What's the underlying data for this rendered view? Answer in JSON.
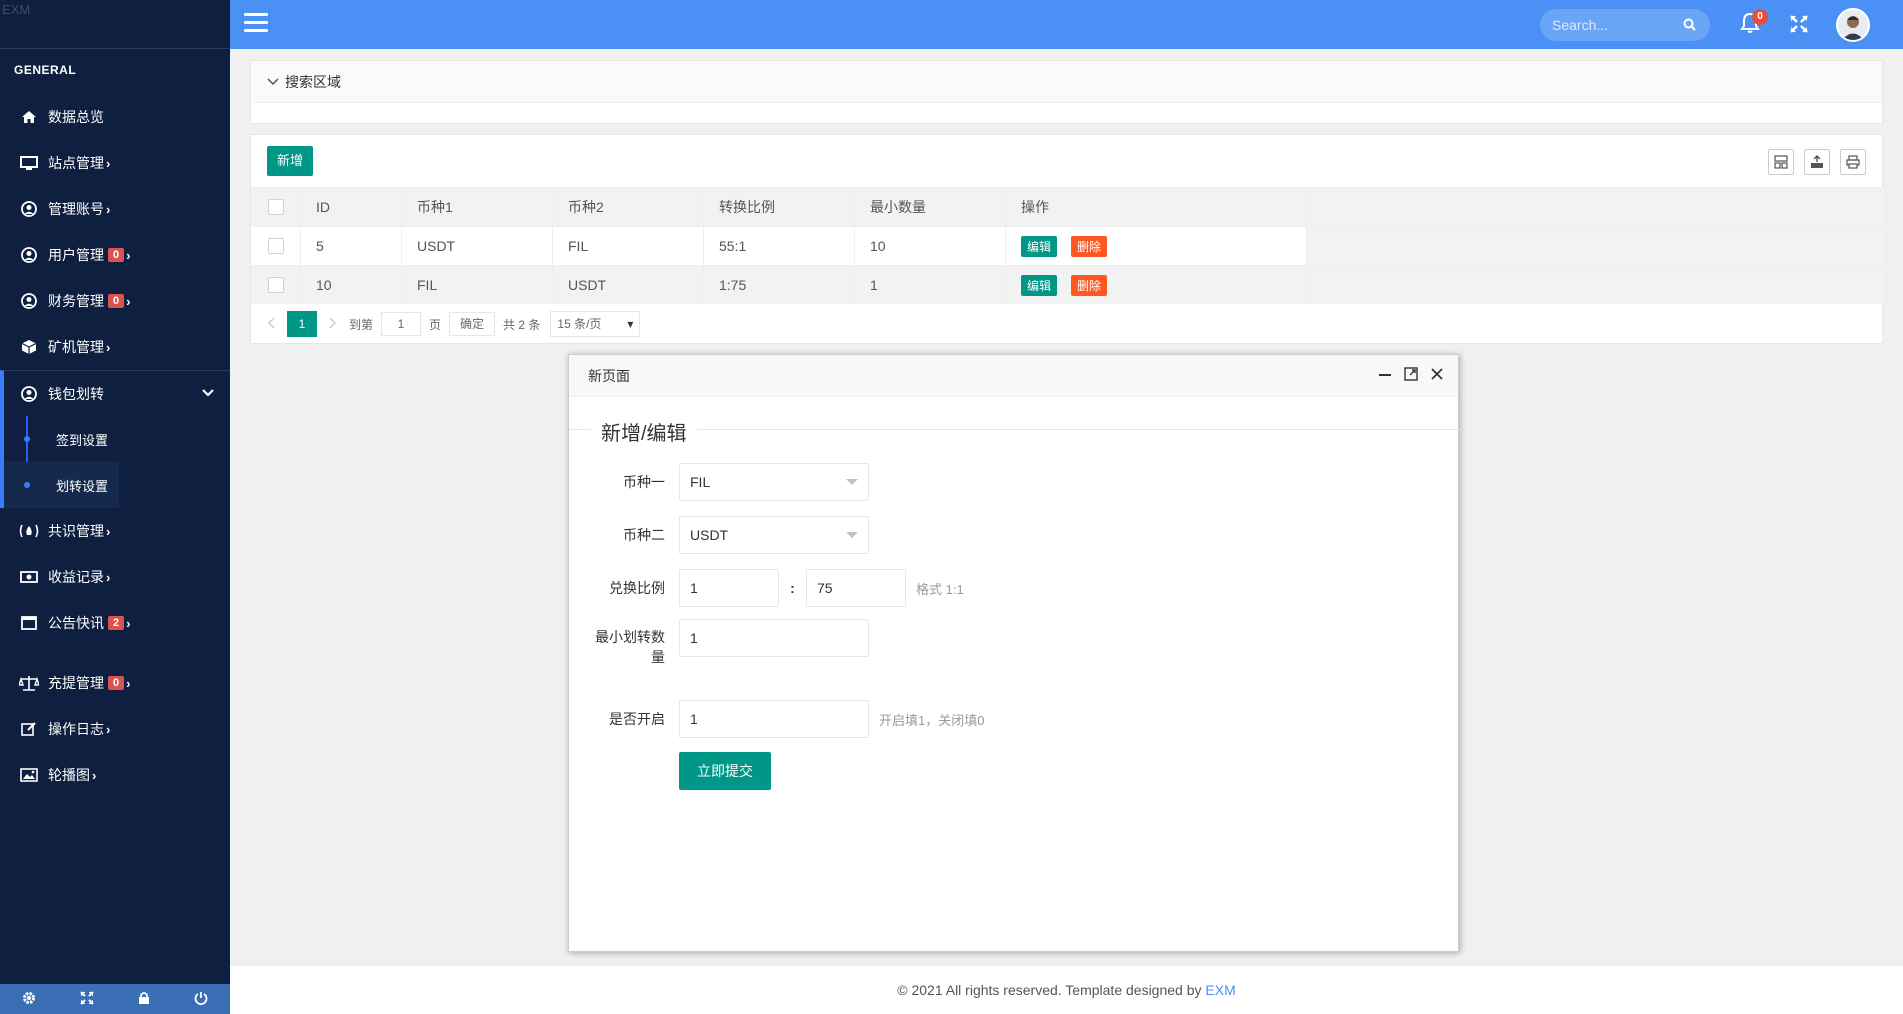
{
  "sidebar": {
    "brand": "EXM",
    "section_title": "GENERAL",
    "items": [
      {
        "label": "数据总览",
        "badge": "",
        "arrow": ""
      },
      {
        "label": "站点管理",
        "badge": "",
        "arrow": "›"
      },
      {
        "label": "管理账号",
        "badge": "",
        "arrow": "›"
      },
      {
        "label": "用户管理",
        "badge": "0",
        "arrow": "›"
      },
      {
        "label": "财务管理",
        "badge": "0",
        "arrow": "›"
      },
      {
        "label": "矿机管理",
        "badge": "",
        "arrow": "›"
      },
      {
        "label": "钱包划转",
        "badge": "",
        "arrow": ""
      },
      {
        "label": "共识管理",
        "badge": "",
        "arrow": "›"
      },
      {
        "label": "收益记录",
        "badge": "",
        "arrow": "›"
      },
      {
        "label": "公告快讯",
        "badge": "2",
        "arrow": "›"
      },
      {
        "label": "充提管理",
        "badge": "0",
        "arrow": "›"
      },
      {
        "label": "操作日志",
        "badge": "",
        "arrow": "›"
      },
      {
        "label": "轮播图",
        "badge": "",
        "arrow": "›"
      }
    ],
    "submenu": [
      "签到设置",
      "划转设置"
    ]
  },
  "header": {
    "search_placeholder": "Search...",
    "notification_count": "0"
  },
  "search_panel": {
    "title": "搜索区域"
  },
  "table": {
    "add_label": "新增",
    "columns": [
      "ID",
      "币种1",
      "币种2",
      "转换比例",
      "最小数量",
      "操作"
    ],
    "rows": [
      {
        "id": "5",
        "coin1": "USDT",
        "coin2": "FIL",
        "ratio": "55:1",
        "min": "10"
      },
      {
        "id": "10",
        "coin1": "FIL",
        "coin2": "USDT",
        "ratio": "1:75",
        "min": "1"
      }
    ],
    "edit_label": "编辑",
    "delete_label": "删除"
  },
  "pager": {
    "current": "1",
    "goto_label": "到第",
    "goto_value": "1",
    "page_label": "页",
    "confirm_label": "确定",
    "total": "共 2 条",
    "per_page": "15 条/页"
  },
  "modal": {
    "title": "新页面",
    "legend": "新增/编辑",
    "fields": {
      "coin1_label": "币种一",
      "coin1_value": "FIL",
      "coin2_label": "币种二",
      "coin2_value": "USDT",
      "ratio_label": "兑换比例",
      "ratio_left": "1",
      "ratio_sep": ":",
      "ratio_right": "75",
      "ratio_hint": "格式 1:1",
      "min_label": "最小划转数量",
      "min_value": "1",
      "open_label": "是否开启",
      "open_value": "1",
      "open_hint": "开启填1，关闭填0"
    },
    "submit_label": "立即提交"
  },
  "footer": {
    "text": "© 2021 All rights reserved. Template designed by ",
    "brand": "EXM"
  }
}
